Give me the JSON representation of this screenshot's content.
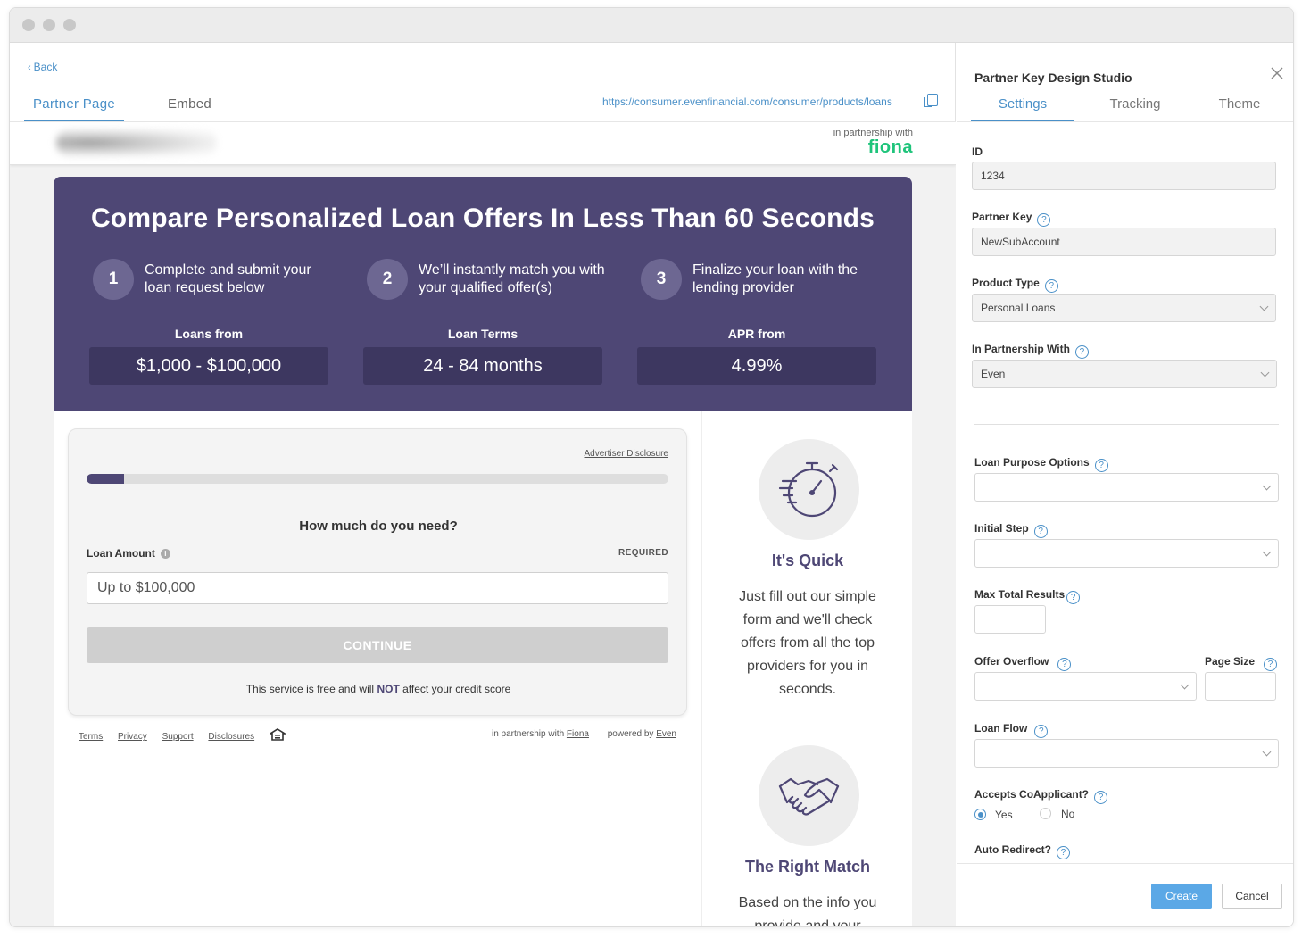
{
  "left": {
    "back_label": "Back",
    "tabs": [
      {
        "label": "Partner Page"
      },
      {
        "label": "Embed"
      }
    ],
    "url": "https://consumer.evenfinancial.com/consumer/products/loans"
  },
  "preview": {
    "partnership_label": "in partnership with",
    "partner_logo_text": "fiona",
    "hero": {
      "title": "Compare Personalized Loan Offers In Less Than 60 Seconds",
      "steps": [
        {
          "num": "1",
          "text": "Complete and submit your loan request below"
        },
        {
          "num": "2",
          "text": "We’ll instantly match you with your qualified offer(s)"
        },
        {
          "num": "3",
          "text": "Finalize your loan with the lending provider"
        }
      ],
      "stats": [
        {
          "label": "Loans from",
          "value": "$1,000 - $100,000"
        },
        {
          "label": "Loan Terms",
          "value": "24 - 84 months"
        },
        {
          "label": "APR from",
          "value": "4.99%"
        }
      ]
    },
    "form": {
      "advertiser_disclosure": "Advertiser Disclosure",
      "progress_fraction": 0.065,
      "question": "How much do you need?",
      "field_label": "Loan Amount",
      "required": "REQUIRED",
      "placeholder": "Up to $100,000",
      "continue_label": "CONTINUE",
      "free_prefix": "This service is free and will ",
      "free_emph": "NOT",
      "free_suffix": " affect your credit score"
    },
    "footer": {
      "links": [
        "Terms",
        "Privacy",
        "Support",
        "Disclosures"
      ],
      "partnership_prefix": "in partnership with ",
      "partnership_name": "Fiona",
      "powered_prefix": "powered by ",
      "powered_name": "Even"
    },
    "features": [
      {
        "title": "It's Quick",
        "text": "Just fill out our simple form and we'll check offers from all the top providers for you in seconds."
      },
      {
        "title": "The Right Match",
        "text": "Based on the info you provide and your"
      }
    ]
  },
  "studio": {
    "title": "Partner Key Design Studio",
    "tabs": [
      {
        "label": "Settings"
      },
      {
        "label": "Tracking"
      },
      {
        "label": "Theme"
      }
    ],
    "fields": {
      "id": {
        "label": "ID",
        "value": "1234"
      },
      "partner_key": {
        "label": "Partner Key",
        "value": "NewSubAccount"
      },
      "product_type": {
        "label": "Product Type",
        "value": "Personal Loans"
      },
      "in_partnership_with": {
        "label": "In Partnership With",
        "value": "Even"
      },
      "loan_purpose_options": {
        "label": "Loan Purpose Options",
        "value": ""
      },
      "initial_step": {
        "label": "Initial Step",
        "value": ""
      },
      "max_total_results": {
        "label": "Max Total Results",
        "value": ""
      },
      "offer_overflow": {
        "label": "Offer Overflow",
        "value": ""
      },
      "page_size": {
        "label": "Page Size",
        "value": ""
      },
      "loan_flow": {
        "label": "Loan Flow",
        "value": ""
      },
      "accepts_coapplicant": {
        "label": "Accepts CoApplicant?",
        "options": [
          "Yes",
          "No"
        ],
        "selected": "Yes"
      },
      "auto_redirect": {
        "label": "Auto Redirect?"
      }
    },
    "help_glyph": "?",
    "create_label": "Create",
    "cancel_label": "Cancel"
  },
  "colors": {
    "brand_purple": "#4e4775",
    "accent_blue": "#4a90c8",
    "fiona_green": "#1fc47b"
  }
}
